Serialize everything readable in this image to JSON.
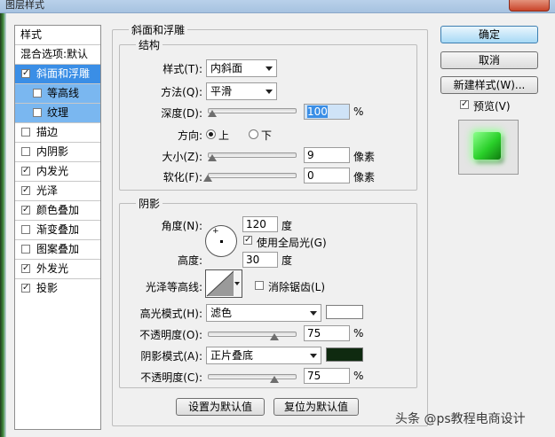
{
  "window": {
    "title": "图层样式"
  },
  "sidebar": {
    "header": "样式",
    "items": [
      {
        "label": "混合选项:默认",
        "checkbox": false,
        "checked": false
      },
      {
        "label": "斜面和浮雕",
        "checkbox": true,
        "checked": true
      },
      {
        "label": "等高线",
        "checkbox": true,
        "checked": false
      },
      {
        "label": "纹理",
        "checkbox": true,
        "checked": false
      },
      {
        "label": "描边",
        "checkbox": true,
        "checked": false
      },
      {
        "label": "内阴影",
        "checkbox": true,
        "checked": false
      },
      {
        "label": "内发光",
        "checkbox": true,
        "checked": true
      },
      {
        "label": "光泽",
        "checkbox": true,
        "checked": true
      },
      {
        "label": "颜色叠加",
        "checkbox": true,
        "checked": true
      },
      {
        "label": "渐变叠加",
        "checkbox": true,
        "checked": false
      },
      {
        "label": "图案叠加",
        "checkbox": true,
        "checked": false
      },
      {
        "label": "外发光",
        "checkbox": true,
        "checked": true
      },
      {
        "label": "投影",
        "checkbox": true,
        "checked": true
      }
    ]
  },
  "bevel": {
    "section_title": "斜面和浮雕",
    "structure_title": "结构",
    "style_label": "样式(T):",
    "style_value": "内斜面",
    "technique_label": "方法(Q):",
    "technique_value": "平滑",
    "depth_label": "深度(D):",
    "depth_value": "100",
    "depth_unit": "%",
    "depth_level": 0.05,
    "direction_label": "方向:",
    "direction_up": "上",
    "direction_down": "下",
    "size_label": "大小(Z):",
    "size_value": "9",
    "size_unit": "像素",
    "size_level": 0.05,
    "soften_label": "软化(F):",
    "soften_value": "0",
    "soften_unit": "像素",
    "soften_level": 0.0
  },
  "shading": {
    "title": "阴影",
    "angle_label": "角度(N):",
    "angle_value": "120",
    "angle_unit": "度",
    "global_light_label": "使用全局光(G)",
    "global_light_checked": true,
    "altitude_label": "高度:",
    "altitude_value": "30",
    "altitude_unit": "度",
    "gloss_contour_label": "光泽等高线:",
    "anti_alias_label": "消除锯齿(L)",
    "anti_alias_checked": false,
    "highlight_mode_label": "高光模式(H):",
    "highlight_mode_value": "滤色",
    "highlight_color": "#ffffff",
    "highlight_opacity_label": "不透明度(O):",
    "highlight_opacity_value": "75",
    "highlight_opacity_level": 0.75,
    "shadow_mode_label": "阴影模式(A):",
    "shadow_mode_value": "正片叠底",
    "shadow_color": "#0f2a10",
    "shadow_opacity_label": "不透明度(C):",
    "shadow_opacity_value": "75",
    "shadow_opacity_level": 0.75,
    "percent": "%"
  },
  "footer": {
    "make_default": "设置为默认值",
    "reset_default": "复位为默认值"
  },
  "actions": {
    "ok": "确定",
    "cancel": "取消",
    "new_style": "新建样式(W)...",
    "preview_label": "预览(V)",
    "preview_checked": true
  },
  "watermark": "头条 @ps教程电商设计"
}
